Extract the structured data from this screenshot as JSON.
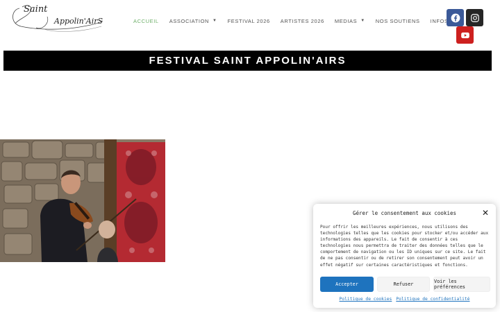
{
  "logo": {
    "line1": "Saint",
    "line2": "Appolin'AirS"
  },
  "nav": [
    {
      "label": "ACCUEIL",
      "active": true,
      "dropdown": false
    },
    {
      "label": "ASSOCIATION",
      "active": false,
      "dropdown": true
    },
    {
      "label": "FESTIVAL 2026",
      "active": false,
      "dropdown": false
    },
    {
      "label": "ARTISTES 2026",
      "active": false,
      "dropdown": false
    },
    {
      "label": "MEDIAS",
      "active": false,
      "dropdown": true
    },
    {
      "label": "NOS SOUTIENS",
      "active": false,
      "dropdown": false
    },
    {
      "label": "INFOS",
      "active": false,
      "dropdown": true
    }
  ],
  "social": {
    "icons": [
      "facebook-icon",
      "instagram-icon",
      "youtube-icon"
    ],
    "colors": {
      "facebook": "#3b5998",
      "instagram": "#262626",
      "youtube": "#cd201f"
    }
  },
  "page_title": "FESTIVAL SAINT APPOLIN'AIRS",
  "cookie": {
    "title": "Gérer le consentement aux cookies",
    "close_icon": "close-icon",
    "body": "Pour offrir les meilleures expériences, nous utilisons des technologies telles que les cookies pour stocker et/ou accéder aux informations des appareils. Le fait de consentir à ces technologies nous permettra de traiter des données telles que le comportement de navigation ou les ID uniques sur ce site. Le fait de ne pas consentir ou de retirer son consentement peut avoir un effet négatif sur certaines caractéristiques et fonctions.",
    "accept_label": "Accepter",
    "refuse_label": "Refuser",
    "prefs_label": "Voir les préférences",
    "cookie_policy_link": "Politique de cookies",
    "privacy_policy_link": "Politique de confidentialité",
    "accent_color": "#1e73be"
  },
  "colors": {
    "active_nav": "#6fb06a",
    "title_bar": "#000000"
  }
}
